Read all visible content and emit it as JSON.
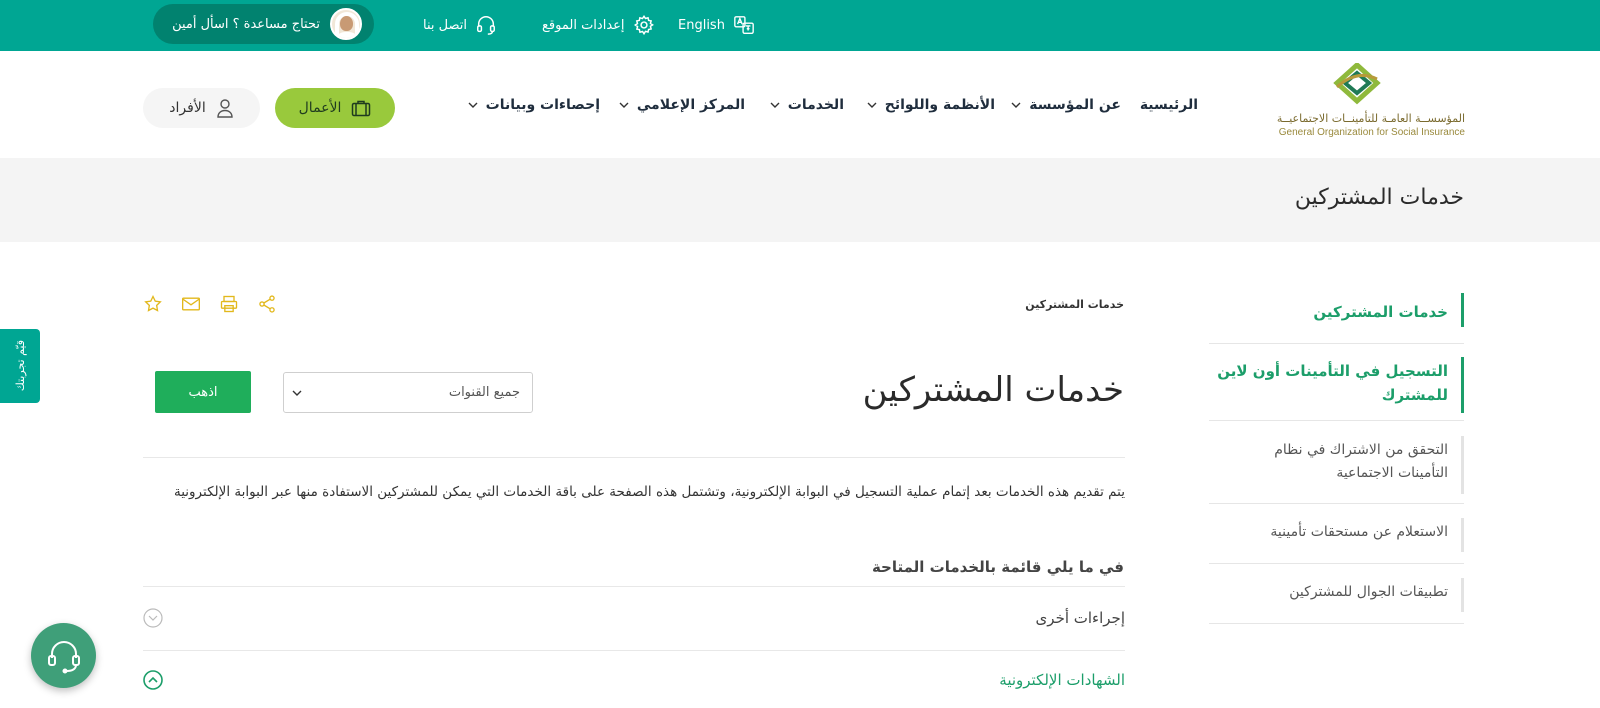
{
  "topbar": {
    "help": "تحتاج مساعدة ؟ اسأل أمين",
    "contact": "اتصل بنا",
    "settings": "إعدادات الموقع",
    "language": "English"
  },
  "logo": {
    "arabic": "المؤسســة العامـة للتأمينــات الاجتماعيــة",
    "english": "General Organization for Social Insurance"
  },
  "nav": {
    "items": [
      {
        "label": "الرئيسية",
        "has_dropdown": false
      },
      {
        "label": "عن المؤسسة",
        "has_dropdown": true
      },
      {
        "label": "الأنظمة واللوائح",
        "has_dropdown": true
      },
      {
        "label": "الخدمات",
        "has_dropdown": true
      },
      {
        "label": "المركز الإعلامي",
        "has_dropdown": true
      },
      {
        "label": "إحصاءات وبيانات",
        "has_dropdown": true
      }
    ],
    "business_button": "الأعمال",
    "individuals_button": "الأفراد"
  },
  "band": {
    "title": "خدمات المشتركين"
  },
  "sidebar": {
    "items": [
      {
        "label": "خدمات المشتركين",
        "active": true
      },
      {
        "label": "التسجيل في التأمينات أون لاين للمشترك",
        "active": true
      },
      {
        "label": "التحقق من الاشتراك في نظام التأمينات الاجتماعية",
        "active": false
      },
      {
        "label": "الاستعلام عن مستحقات تأمينية",
        "active": false
      },
      {
        "label": "تطبيقات الجوال للمشتركين",
        "active": false
      }
    ]
  },
  "main": {
    "breadcrumb": "خدمات المشتركين",
    "title": "خدمات المشتركين",
    "filter": {
      "selected": "جميع القنوات"
    },
    "go_button": "اذهب",
    "description": "يتم تقديم هذه الخدمات بعد إتمام عملية التسجيل في البوابة الإلكترونية، وتشتمل هذه الصفحة على باقة الخدمات التي يمكن للمشتركين الاستفادة منها عبر البوابة الإلكترونية",
    "list_heading": "في ما يلي قائمة بالخدمات المتاحة",
    "accordion": [
      {
        "label": "إجراءات أخرى",
        "expanded": false
      },
      {
        "label": "الشهادات الإلكترونية",
        "expanded": true
      }
    ]
  },
  "rate_tab": "قيّم تجربتك",
  "colors": {
    "brand_teal": "#00a693",
    "business_green": "#99c93c",
    "active_green": "#1c9e6a",
    "button_green": "#1fae5b",
    "tool_yellow": "#e2b81c"
  }
}
